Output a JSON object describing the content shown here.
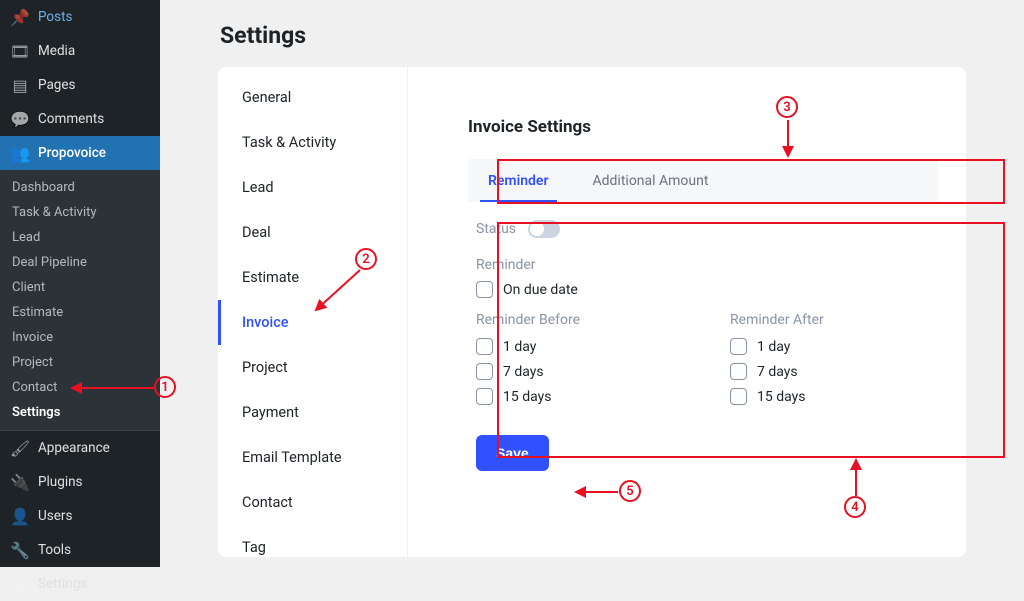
{
  "wp_sidebar": {
    "items_top": [
      {
        "icon": "📌",
        "label": "Posts"
      },
      {
        "icon": "🖼",
        "label": "Media"
      },
      {
        "icon": "📄",
        "label": "Pages"
      },
      {
        "icon": "💬",
        "label": "Comments"
      }
    ],
    "active": {
      "icon": "👥",
      "label": "Propovoice"
    },
    "sub_items": [
      "Dashboard",
      "Task & Activity",
      "Lead",
      "Deal Pipeline",
      "Client",
      "Estimate",
      "Invoice",
      "Project",
      "Contact",
      "Settings"
    ],
    "sub_bold_index": 9,
    "items_bottom": [
      {
        "icon": "🖌",
        "label": "Appearance"
      },
      {
        "icon": "🔌",
        "label": "Plugins"
      },
      {
        "icon": "👤",
        "label": "Users"
      },
      {
        "icon": "🔧",
        "label": "Tools"
      },
      {
        "icon": "⚙",
        "label": "Settings"
      }
    ]
  },
  "page_title": "Settings",
  "settings_nav": [
    "General",
    "Task & Activity",
    "Lead",
    "Deal",
    "Estimate",
    "Invoice",
    "Project",
    "Payment",
    "Email Template",
    "Contact",
    "Tag"
  ],
  "settings_nav_active_index": 5,
  "section_title": "Invoice Settings",
  "tabs": [
    "Reminder",
    "Additional Amount"
  ],
  "active_tab_index": 0,
  "status_label": "Status",
  "reminder_label": "Reminder",
  "on_due_date": "On due date",
  "before_label": "Reminder Before",
  "after_label": "Reminder After",
  "before_opts": [
    "1 day",
    "7 days",
    "15 days"
  ],
  "after_opts": [
    "1 day",
    "7 days",
    "15 days"
  ],
  "save_label": "Save",
  "annotations": {
    "n1": "1",
    "n2": "2",
    "n3": "3",
    "n4": "4",
    "n5": "5"
  }
}
